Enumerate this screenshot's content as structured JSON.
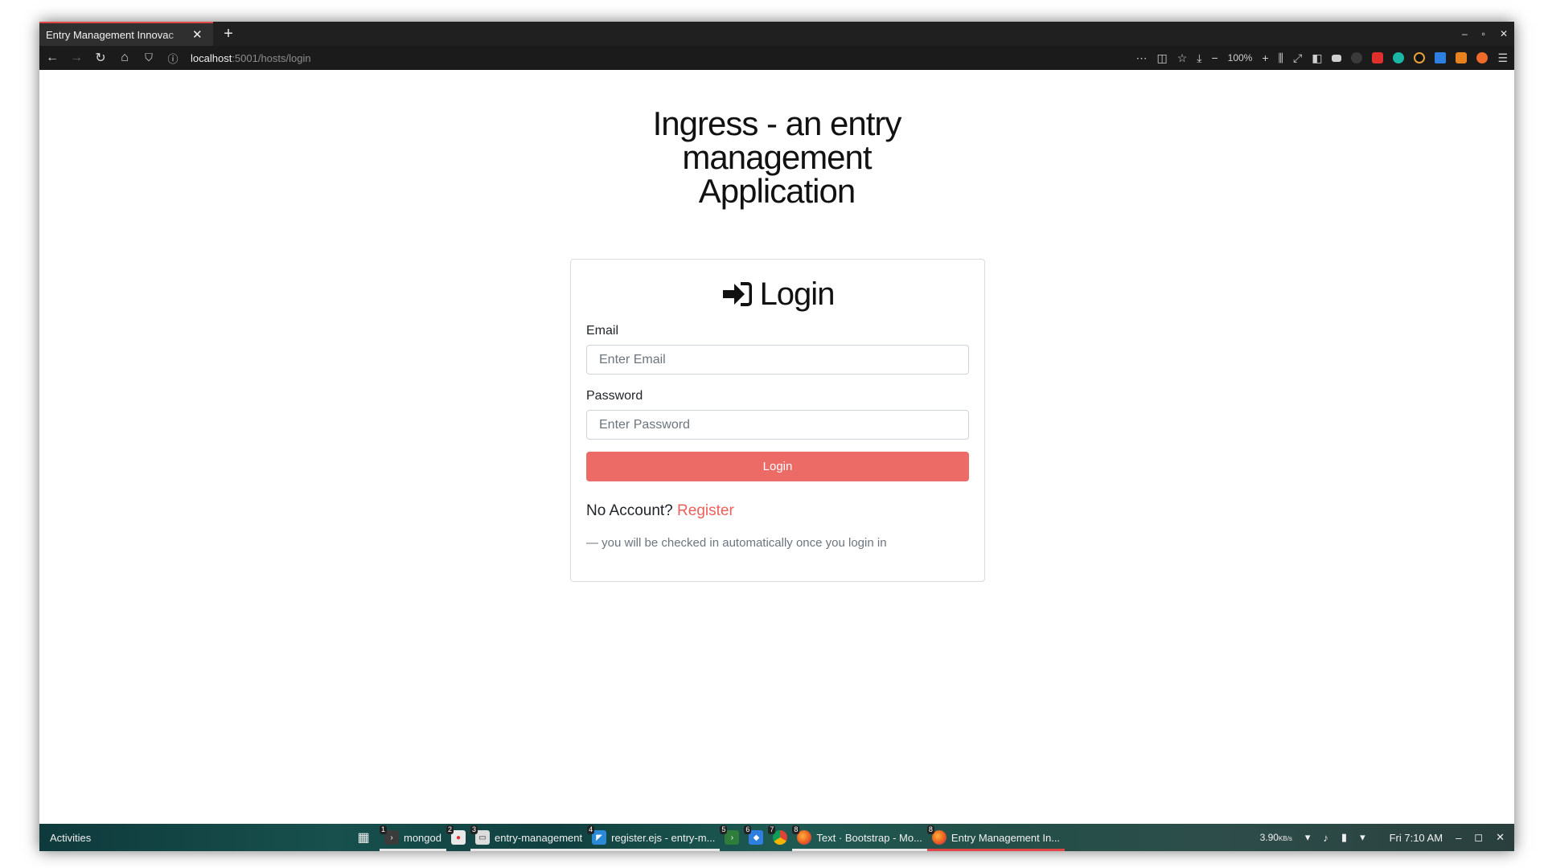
{
  "browser": {
    "tab_title": "Entry Management Innovac",
    "new_tab": "+",
    "url_host": "localhost",
    "url_path": ":5001/hosts/login",
    "zoom": "100%",
    "window_controls": [
      "–",
      "▫",
      "✕"
    ]
  },
  "page": {
    "title_line1": "Ingress - an entry management",
    "title_line2": "Application",
    "card": {
      "heading": "Login",
      "email_label": "Email",
      "email_placeholder": "Enter Email",
      "password_label": "Password",
      "password_placeholder": "Enter Password",
      "login_button": "Login",
      "no_account": "No Account?",
      "register_link": "Register",
      "note": "— you will be checked in automatically once you login in"
    },
    "accent_color": "#ec6b66"
  },
  "taskbar": {
    "activities": "Activities",
    "tasks": [
      {
        "num": "1",
        "label": "mongod",
        "icon": "terminal-icon"
      },
      {
        "num": "2",
        "label": "",
        "icon": "app-icon"
      },
      {
        "num": "3",
        "label": "entry-management",
        "icon": "files-icon"
      },
      {
        "num": "4",
        "label": "register.ejs - entry-m...",
        "icon": "vscode-icon"
      },
      {
        "num": "5",
        "label": "",
        "icon": "terminal-icon"
      },
      {
        "num": "6",
        "label": "",
        "icon": "app-icon"
      },
      {
        "num": "7",
        "label": "",
        "icon": "chrome-icon"
      },
      {
        "num": "8",
        "label": "Text · Bootstrap - Mo...",
        "icon": "firefox-icon"
      },
      {
        "num": "8",
        "label": "Entry Management In...",
        "icon": "firefox-icon"
      }
    ],
    "net_speed": "3.90",
    "net_unit": "KB/s",
    "clock": "Fri  7:10 AM"
  }
}
